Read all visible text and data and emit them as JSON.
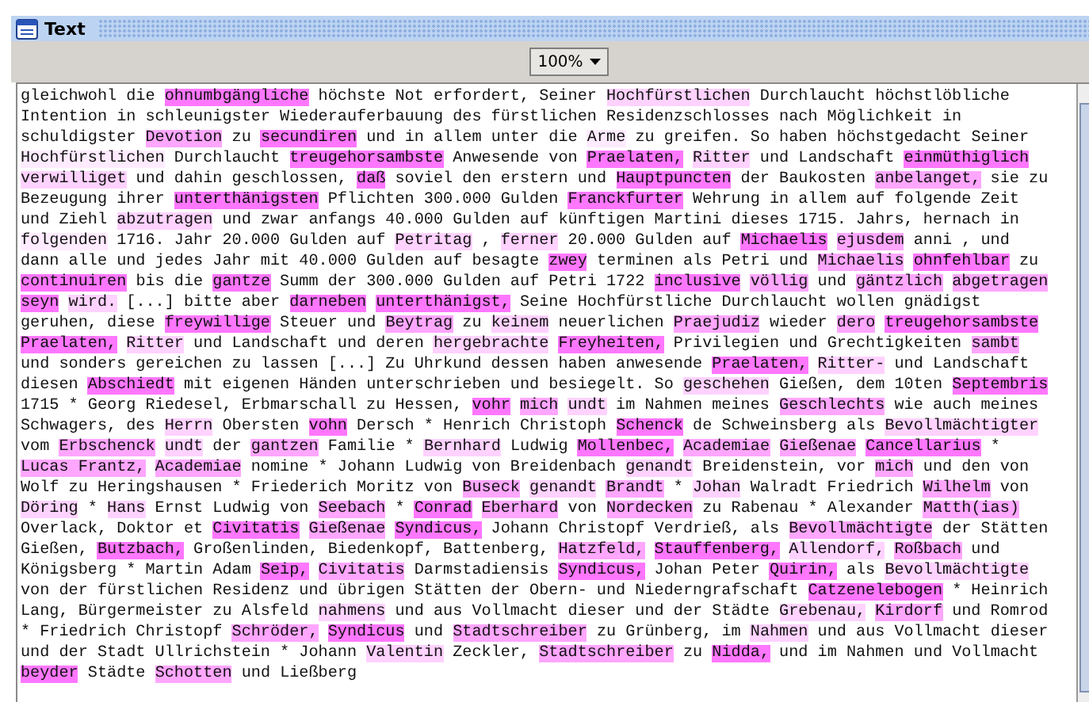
{
  "window": {
    "title": "Text"
  },
  "toolbar": {
    "zoom": "100%"
  },
  "text": {
    "lines": [
      [
        {
          "text": "gleichwohl die "
        },
        {
          "text": "ohnumbgängliche",
          "color": "#ff77ff"
        },
        {
          "text": " höchste Not erfordert, Seiner "
        },
        {
          "text": "Hochfürstlichen",
          "color": "#ffd2ff"
        },
        {
          "text": " Durchlaucht höchstlöbliche"
        }
      ],
      [
        {
          "text": "Intention in schleunigster Wiederauferbauung des fürstlichen Residenzschlosses nach Möglichkeit in"
        }
      ],
      [
        {
          "text": "schuldigster "
        },
        {
          "text": "Devotion",
          "color": "#ffa6ff"
        },
        {
          "text": " zu "
        },
        {
          "text": "secundiren",
          "color": "#ff77ff"
        },
        {
          "text": " und in allem unter die "
        },
        {
          "text": "Arme",
          "color": "#ffebff"
        },
        {
          "text": " zu greifen. So haben höchstgedacht Seiner"
        }
      ],
      [
        {
          "text": "Hochfürstlichen",
          "color": "#ffebff"
        },
        {
          "text": " Durchlaucht "
        },
        {
          "text": "treugehorsambste",
          "color": "#ff77ff"
        },
        {
          "text": " Anwesende von "
        },
        {
          "text": "Praelaten,",
          "color": "#ff77ff",
          "space_after": true
        },
        {
          "text": "Ritter",
          "color": "#ffd2ff"
        },
        {
          "text": " und Landschaft "
        },
        {
          "text": "einmüthiglich",
          "color": "#ff77ff"
        }
      ],
      [
        {
          "text": "verwilliget",
          "color": "#ffd2ff"
        },
        {
          "text": " und dahin geschlossen, "
        },
        {
          "text": "daß",
          "color": "#ff77ff"
        },
        {
          "text": " soviel den erstern und "
        },
        {
          "text": "Hauptpuncten",
          "color": "#ff77ff"
        },
        {
          "text": " der Baukosten "
        },
        {
          "text": "anbelanget,",
          "color": "#ffa6ff"
        },
        {
          "text": " sie zu"
        }
      ],
      [
        {
          "text": "Bezeugung ihrer "
        },
        {
          "text": "unterthänigsten",
          "color": "#ff77ff"
        },
        {
          "text": " Pflichten 300.000 Gulden "
        },
        {
          "text": "Franckfurter",
          "color": "#ff77ff"
        },
        {
          "text": " Wehrung in allem auf folgende Zeit"
        }
      ],
      [
        {
          "text": "und Ziehl "
        },
        {
          "text": "abzutragen",
          "color": "#ffd2ff"
        },
        {
          "text": " und zwar anfangs 40.000 Gulden auf künftigen Martini dieses 1715. Jahrs, hernach in"
        }
      ],
      [
        {
          "text": "folgenden",
          "color": "#ffebff"
        },
        {
          "text": " 1716. Jahr 20.000 Gulden auf "
        },
        {
          "text": "Petritag",
          "color": "#ffd2ff"
        },
        {
          "text": " , "
        },
        {
          "text": "ferner",
          "color": "#ffd2ff"
        },
        {
          "text": " 20.000 Gulden auf "
        },
        {
          "text": "Michaelis",
          "color": "#ff77ff",
          "space_after": true
        },
        {
          "text": "ejusdem",
          "color": "#ffa6ff"
        },
        {
          "text": " anni , und"
        }
      ],
      [
        {
          "text": "dann alle und jedes Jahr mit 40.000 Gulden auf besagte "
        },
        {
          "text": "zwey",
          "color": "#ff77ff"
        },
        {
          "text": " terminen als Petri und "
        },
        {
          "text": "Michaelis",
          "color": "#ffa6ff",
          "space_after": true
        },
        {
          "text": "ohnfehlbar",
          "color": "#ff77ff"
        },
        {
          "text": " zu"
        }
      ],
      [
        {
          "text": "continuiren",
          "color": "#ff77ff"
        },
        {
          "text": " bis die "
        },
        {
          "text": "gantze",
          "color": "#ff77ff"
        },
        {
          "text": " Summ der 300.000 Gulden auf Petri 1722 "
        },
        {
          "text": "inclusive",
          "color": "#ff77ff",
          "space_after": true
        },
        {
          "text": "völlig",
          "color": "#ffa6ff"
        },
        {
          "text": " und "
        },
        {
          "text": "gäntzlich",
          "color": "#ffa6ff",
          "space_after": true
        },
        {
          "text": "abgetragen",
          "color": "#ffa6ff"
        }
      ],
      [
        {
          "text": "seyn",
          "color": "#ff77ff",
          "space_after": true
        },
        {
          "text": "wird.",
          "color": "#ffd2ff"
        },
        {
          "text": " [...] bitte aber "
        },
        {
          "text": "darneben",
          "color": "#ff77ff",
          "space_after": true
        },
        {
          "text": "unterthänigst,",
          "color": "#ff77ff"
        },
        {
          "text": " Seine Hochfürstliche Durchlaucht wollen gnädigst"
        }
      ],
      [
        {
          "text": "geruhen, diese "
        },
        {
          "text": "freywillige",
          "color": "#ff77ff"
        },
        {
          "text": " Steuer und "
        },
        {
          "text": "Beytrag",
          "color": "#ffa6ff"
        },
        {
          "text": " zu "
        },
        {
          "text": "keinem",
          "color": "#ffd2ff"
        },
        {
          "text": " neuerlichen "
        },
        {
          "text": "Praejudiz",
          "color": "#ffa6ff"
        },
        {
          "text": " wieder "
        },
        {
          "text": "dero",
          "color": "#ffa6ff",
          "space_after": true
        },
        {
          "text": "treugehorsambste",
          "color": "#ff77ff"
        }
      ],
      [
        {
          "text": "Praelaten,",
          "color": "#ff77ff",
          "space_after": true
        },
        {
          "text": "Ritter",
          "color": "#ffd2ff"
        },
        {
          "text": " und Landschaft und deren "
        },
        {
          "text": "hergebrachte",
          "color": "#ffd2ff",
          "space_after": true
        },
        {
          "text": "Freyheiten,",
          "color": "#ff77ff"
        },
        {
          "text": " Privilegien und Grechtigkeiten "
        },
        {
          "text": "sambt",
          "color": "#ffa6ff"
        }
      ],
      [
        {
          "text": "und sonders gereichen zu lassen [...] Zu Uhrkund dessen haben anwesende "
        },
        {
          "text": "Praelaten,",
          "color": "#ff77ff",
          "space_after": true
        },
        {
          "text": "Ritter-",
          "color": "#ffd2ff"
        },
        {
          "text": " und Landschaft"
        }
      ],
      [
        {
          "text": "diesen "
        },
        {
          "text": "Abschiedt",
          "color": "#ff77ff"
        },
        {
          "text": " mit eigenen Händen unterschrieben und besiegelt. So "
        },
        {
          "text": "geschehen",
          "color": "#ffd2ff"
        },
        {
          "text": " Gießen, dem 10ten "
        },
        {
          "text": "Septembris",
          "color": "#ff77ff"
        }
      ],
      [
        {
          "text": "1715 * Georg Riedesel, Erbmarschall zu Hessen, "
        },
        {
          "text": "vohr",
          "color": "#ff77ff",
          "space_after": true
        },
        {
          "text": "mich",
          "color": "#ffa6ff",
          "space_after": true
        },
        {
          "text": "undt",
          "color": "#ffd2ff"
        },
        {
          "text": " im Nahmen meines "
        },
        {
          "text": "Geschlechts",
          "color": "#ffa6ff"
        },
        {
          "text": " wie auch meines"
        }
      ],
      [
        {
          "text": "Schwagers, des "
        },
        {
          "text": "Herrn",
          "color": "#ffd2ff"
        },
        {
          "text": " Obersten "
        },
        {
          "text": "vohn",
          "color": "#ff77ff"
        },
        {
          "text": " Dersch * Henrich Christoph "
        },
        {
          "text": "Schenck",
          "color": "#ff77ff"
        },
        {
          "text": " de Schweinsberg als "
        },
        {
          "text": "Bevollmächtigter",
          "color": "#ffd2ff"
        }
      ],
      [
        {
          "text": "vom "
        },
        {
          "text": "Erbschenck",
          "color": "#ffa6ff",
          "space_after": true
        },
        {
          "text": "undt",
          "color": "#ffd2ff"
        },
        {
          "text": " der "
        },
        {
          "text": "gantzen",
          "color": "#ffa6ff"
        },
        {
          "text": " Familie * "
        },
        {
          "text": "Bernhard",
          "color": "#ffd2ff"
        },
        {
          "text": " Ludwig "
        },
        {
          "text": "Mollenbec,",
          "color": "#ff77ff",
          "space_after": true
        },
        {
          "text": "Academiae",
          "color": "#ffa6ff",
          "space_after": true
        },
        {
          "text": "Gießenae",
          "color": "#ffa6ff",
          "space_after": true
        },
        {
          "text": "Cancellarius",
          "color": "#ff77ff"
        },
        {
          "text": " *"
        }
      ],
      [
        {
          "text": "Lucas Frantz,",
          "color": "#ffa6ff",
          "space_after": true
        },
        {
          "text": "Academiae",
          "color": "#ffa6ff"
        },
        {
          "text": " nomine * Johann Ludwig von Breidenbach "
        },
        {
          "text": "genandt",
          "color": "#ffd2ff"
        },
        {
          "text": " Breidenstein, vor "
        },
        {
          "text": "mich",
          "color": "#ffa6ff"
        },
        {
          "text": " und den von"
        }
      ],
      [
        {
          "text": "Wolf zu Heringshausen * Friederich Moritz von "
        },
        {
          "text": "Buseck",
          "color": "#ffa6ff",
          "space_after": true
        },
        {
          "text": "genandt",
          "color": "#ffd2ff",
          "space_after": true
        },
        {
          "text": "Brandt",
          "color": "#ffa6ff"
        },
        {
          "text": " * "
        },
        {
          "text": "Johan",
          "color": "#ffd2ff"
        },
        {
          "text": " Walradt Friedrich "
        },
        {
          "text": "Wilhelm",
          "color": "#ffa6ff"
        },
        {
          "text": " von"
        }
      ],
      [
        {
          "text": "Döring",
          "color": "#ffd2ff"
        },
        {
          "text": " * "
        },
        {
          "text": "Hans",
          "color": "#ffd2ff"
        },
        {
          "text": " Ernst Ludwig von "
        },
        {
          "text": "Seebach",
          "color": "#ffa6ff"
        },
        {
          "text": " * "
        },
        {
          "text": "Conrad",
          "color": "#ff77ff",
          "space_after": true
        },
        {
          "text": "Eberhard",
          "color": "#ffa6ff"
        },
        {
          "text": " von "
        },
        {
          "text": "Nordecken",
          "color": "#ffa6ff"
        },
        {
          "text": " zu Rabenau * Alexander "
        },
        {
          "text": "Matth(ias)",
          "color": "#ffa6ff"
        }
      ],
      [
        {
          "text": "Overlack, Doktor et "
        },
        {
          "text": "Civitatis",
          "color": "#ff77ff",
          "space_after": true
        },
        {
          "text": "Gießenae",
          "color": "#ffa6ff",
          "space_after": true
        },
        {
          "text": "Syndicus,",
          "color": "#ff77ff"
        },
        {
          "text": " Johann Christopf Verdrieß, als "
        },
        {
          "text": "Bevollmächtigte",
          "color": "#ffa6ff"
        },
        {
          "text": " der Stätten"
        }
      ],
      [
        {
          "text": "Gießen, "
        },
        {
          "text": "Butzbach,",
          "color": "#ff77ff"
        },
        {
          "text": " Großenlinden, Biedenkopf, Battenberg, "
        },
        {
          "text": "Hatzfeld,",
          "color": "#ffa6ff",
          "space_after": true
        },
        {
          "text": "Stauffenberg,",
          "color": "#ff77ff",
          "space_after": true
        },
        {
          "text": "Allendorf,",
          "color": "#ffd2ff",
          "space_after": true
        },
        {
          "text": "Roßbach",
          "color": "#ffa6ff"
        },
        {
          "text": " und"
        }
      ],
      [
        {
          "text": "Königsberg * Martin Adam "
        },
        {
          "text": "Seip,",
          "color": "#ff77ff",
          "space_after": true
        },
        {
          "text": "Civitatis",
          "color": "#ffa6ff"
        },
        {
          "text": " Darmstadiensis "
        },
        {
          "text": "Syndicus,",
          "color": "#ff77ff"
        },
        {
          "text": " Johan Peter "
        },
        {
          "text": "Quirin,",
          "color": "#ff77ff"
        },
        {
          "text": " als "
        },
        {
          "text": "Bevollmächtigte",
          "color": "#ffd2ff"
        }
      ],
      [
        {
          "text": "von der fürstlichen Residenz und übrigen Stätten der Obern- und Niederngrafschaft "
        },
        {
          "text": "Catzenelebogen",
          "color": "#ff77ff"
        },
        {
          "text": " * Heinrich"
        }
      ],
      [
        {
          "text": "Lang, Bürgermeister zu Alsfeld "
        },
        {
          "text": "nahmens",
          "color": "#ffd2ff"
        },
        {
          "text": " und aus Vollmacht dieser und der Städte "
        },
        {
          "text": "Grebenau,",
          "color": "#ffd2ff",
          "space_after": true
        },
        {
          "text": "Kirdorf",
          "color": "#ffa6ff"
        },
        {
          "text": " und Romrod"
        }
      ],
      [
        {
          "text": "* Friedrich Christopf "
        },
        {
          "text": "Schröder,",
          "color": "#ffa6ff",
          "space_after": true
        },
        {
          "text": "Syndicus",
          "color": "#ff77ff"
        },
        {
          "text": " und "
        },
        {
          "text": "Stadtschreiber",
          "color": "#ffa6ff"
        },
        {
          "text": " zu Grünberg, im "
        },
        {
          "text": "Nahmen",
          "color": "#ffd2ff"
        },
        {
          "text": " und aus Vollmacht dieser"
        }
      ],
      [
        {
          "text": "und der Stadt Ullrichstein * Johann "
        },
        {
          "text": "Valentin",
          "color": "#ffd2ff"
        },
        {
          "text": " Zeckler, "
        },
        {
          "text": "Stadtschreiber",
          "color": "#ffa6ff"
        },
        {
          "text": " zu "
        },
        {
          "text": "Nidda,",
          "color": "#ff77ff"
        },
        {
          "text": " und im Nahmen und Vollmacht"
        }
      ],
      [
        {
          "text": "beyder",
          "color": "#ff77ff"
        },
        {
          "text": " Städte "
        },
        {
          "text": "Schotten",
          "color": "#ffa6ff"
        },
        {
          "text": " und Ließberg"
        }
      ]
    ]
  }
}
